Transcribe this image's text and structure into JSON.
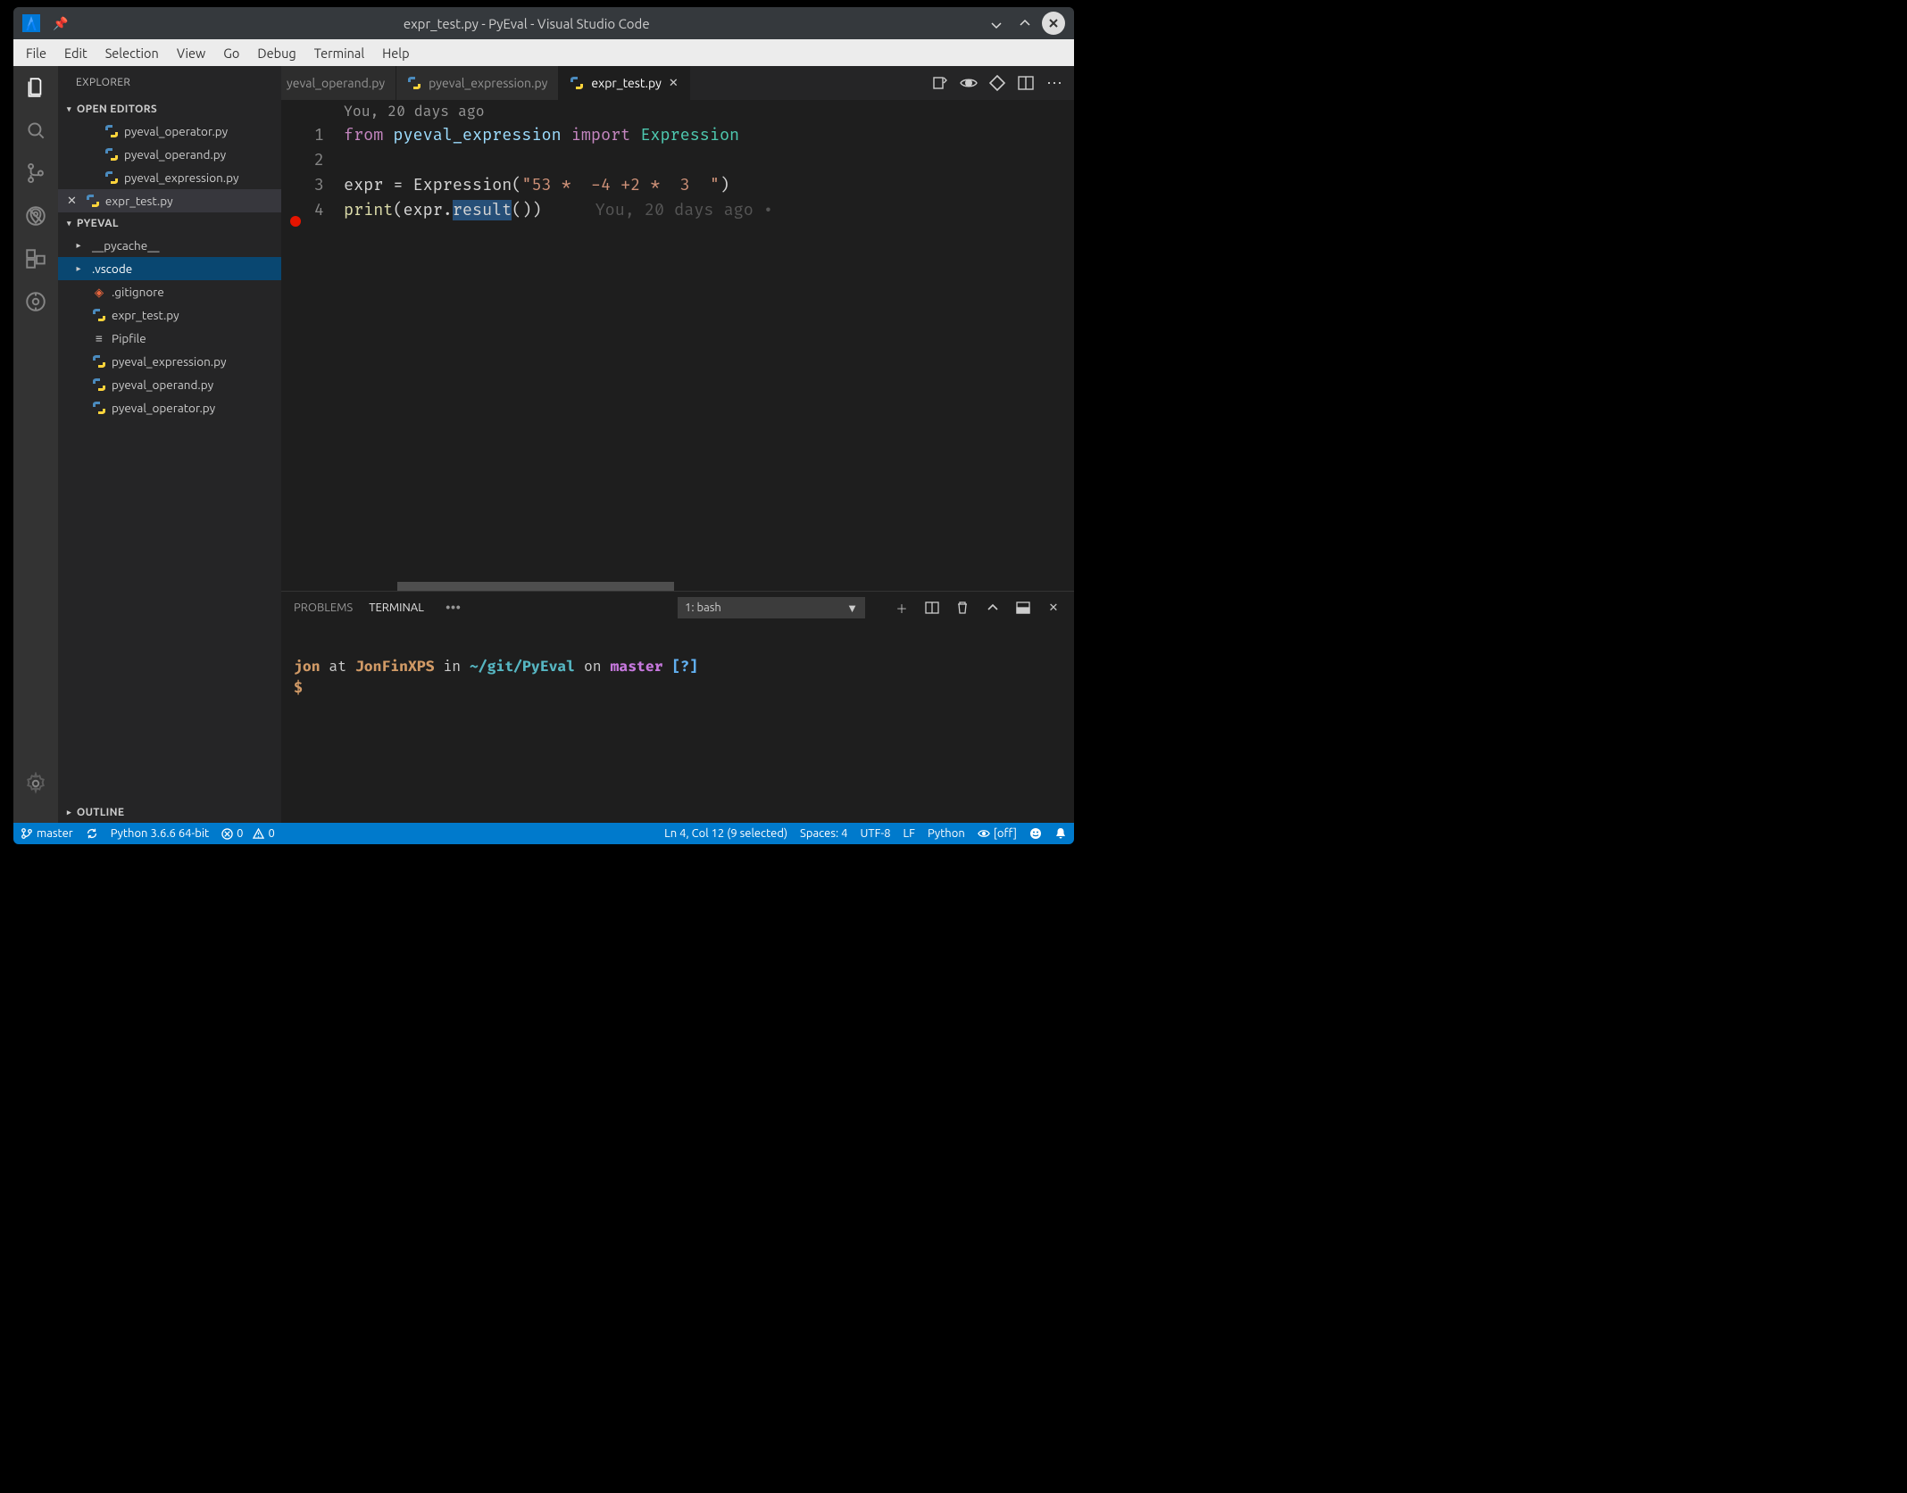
{
  "titlebar": {
    "title": "expr_test.py - PyEval - Visual Studio Code"
  },
  "menubar": [
    "File",
    "Edit",
    "Selection",
    "View",
    "Go",
    "Debug",
    "Terminal",
    "Help"
  ],
  "sidebar": {
    "title": "EXPLORER",
    "open_editors_hdr": "OPEN EDITORS",
    "open_editors": [
      "pyeval_operator.py",
      "pyeval_operand.py",
      "pyeval_expression.py",
      "expr_test.py"
    ],
    "project_hdr": "PYEVAL",
    "tree": [
      {
        "type": "folder",
        "label": "__pycache__"
      },
      {
        "type": "folder",
        "label": ".vscode",
        "selected": true
      },
      {
        "type": "file",
        "label": ".gitignore",
        "icon": "git"
      },
      {
        "type": "file",
        "label": "expr_test.py",
        "icon": "py"
      },
      {
        "type": "file",
        "label": "Pipfile",
        "icon": "pip"
      },
      {
        "type": "file",
        "label": "pyeval_expression.py",
        "icon": "py"
      },
      {
        "type": "file",
        "label": "pyeval_operand.py",
        "icon": "py"
      },
      {
        "type": "file",
        "label": "pyeval_operator.py",
        "icon": "py"
      }
    ],
    "outline_hdr": "OUTLINE"
  },
  "tabs": {
    "items": [
      {
        "label": "yeval_operand.py",
        "partial": true
      },
      {
        "label": "pyeval_expression.py"
      },
      {
        "label": "expr_test.py",
        "active": true,
        "closeable": true
      }
    ]
  },
  "editor": {
    "codelens": "You, 20 days ago",
    "line_numbers": [
      "1",
      "2",
      "3",
      "4"
    ],
    "blame_inline": "You, 20 days ago •",
    "code": {
      "from": "from",
      "mod": "pyeval_expression",
      "import": "import",
      "cls": "Expression",
      "l3_lhs": "expr = Expression(",
      "l3_str": "\"53 *  -4 +2 *  3  \"",
      "l3_end": ")",
      "l4_print": "print",
      "l4_open": "(expr.",
      "l4_sel": "result",
      "l4_close": "())"
    }
  },
  "panel": {
    "tabs": {
      "problems": "PROBLEMS",
      "terminal": "TERMINAL"
    },
    "terminal_selector": "1: bash",
    "prompt": {
      "user": "jon",
      "at": " at ",
      "host": "JonFinXPS",
      "in": " in ",
      "path": "~/git/PyEval",
      "on": " on ",
      "branch": "master",
      "flag": " [?]",
      "ps": "$"
    }
  },
  "statusbar": {
    "branch": "master",
    "python": "Python 3.6.6 64-bit",
    "errors": "0",
    "warnings": "0",
    "pos": "Ln 4, Col 12 (9 selected)",
    "spaces": "Spaces: 4",
    "encoding": "UTF-8",
    "eol": "LF",
    "lang": "Python",
    "live": "[off]"
  }
}
